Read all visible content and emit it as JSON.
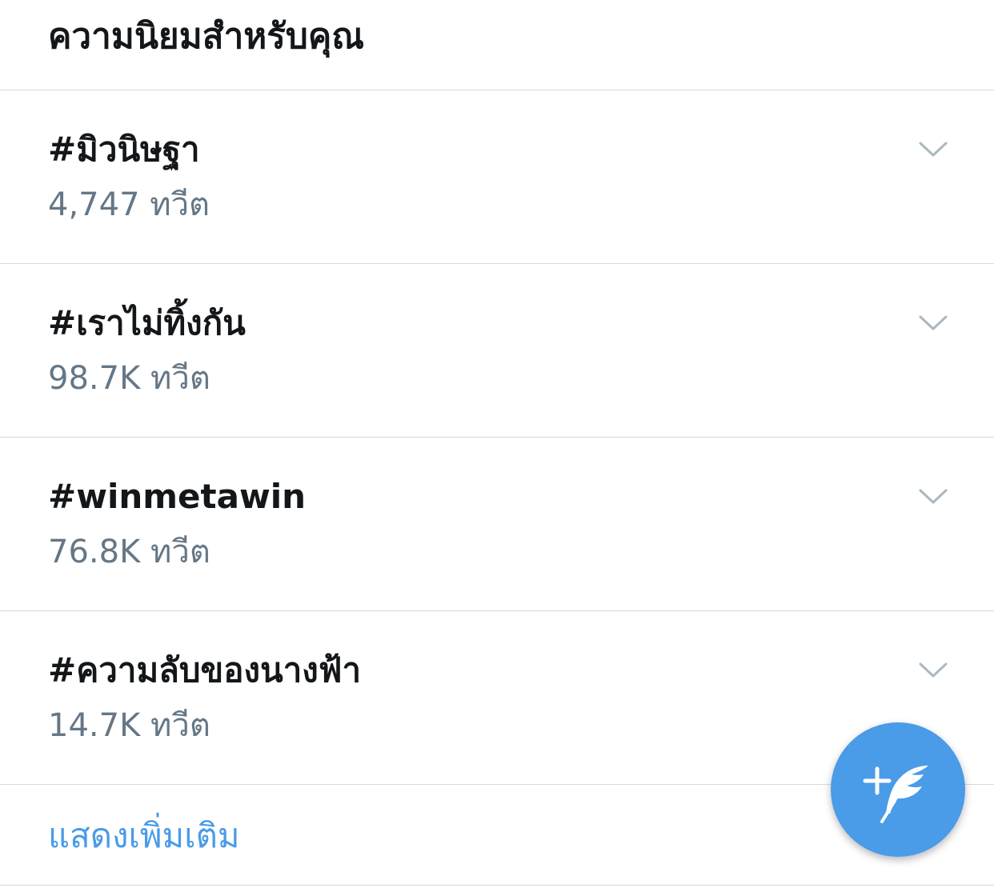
{
  "header": {
    "title": "ความนิยมสำหรับคุณ"
  },
  "trends": [
    {
      "name": "#มิวนิษฐา",
      "count": "4,747 ทวีต"
    },
    {
      "name": "#เราไม่ทิ้งกัน",
      "count": "98.7K ทวีต"
    },
    {
      "name": "#winmetawin",
      "count": "76.8K ทวีต"
    },
    {
      "name": "#ความลับของนางฟ้า",
      "count": "14.7K ทวีต"
    }
  ],
  "show_more": {
    "label": "แสดงเพิ่มเติม"
  },
  "icons": {
    "trend_menu": "chevron-down-icon",
    "compose": "compose-tweet-icon"
  },
  "colors": {
    "accent": "#4a9be8",
    "text_primary": "#14171a",
    "text_secondary": "#657786",
    "divider": "#d6d9db",
    "chevron": "#aab8c2"
  }
}
